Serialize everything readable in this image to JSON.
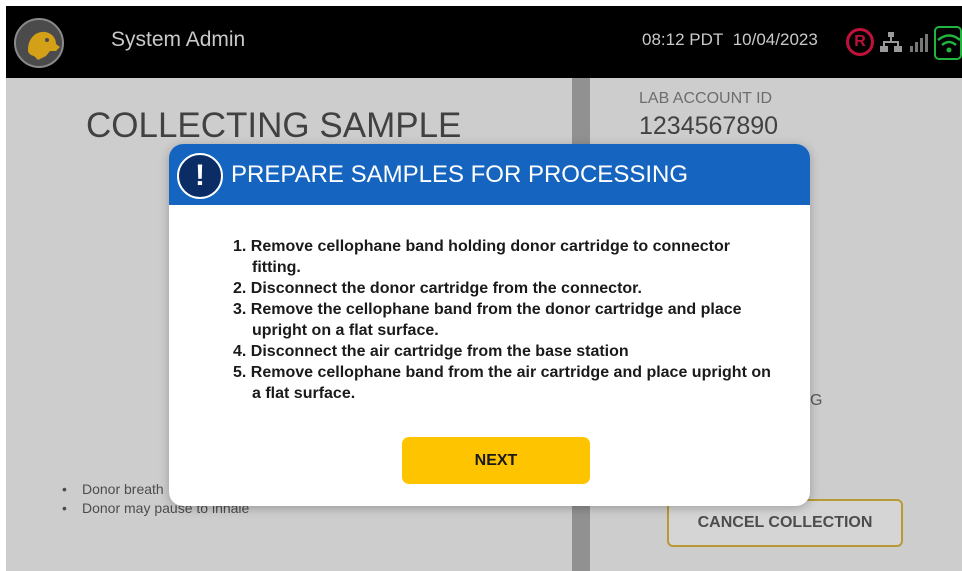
{
  "header": {
    "title": "System Admin",
    "time": "08:12 PDT",
    "date": "10/04/2023",
    "record_indicator": "R",
    "icons": [
      "dog-logo-icon",
      "record-icon",
      "network-icon",
      "signal-icon",
      "wifi-icon"
    ]
  },
  "main": {
    "title": "COLLECTING SAMPLE",
    "instructions": [
      "Donor breath",
      "Donor may pause to inhale"
    ]
  },
  "side_panel": {
    "account_label": "LAB ACCOUNT ID",
    "account_id": "1234567890",
    "status_fragment": "G",
    "cancel_label": "CANCEL COLLECTION"
  },
  "modal": {
    "title": "PREPARE SAMPLES FOR PROCESSING",
    "steps": [
      "1. Remove cellophane band holding donor cartridge to connector fitting.",
      "2. Disconnect the donor cartridge from the connector.",
      "3. Remove the cellophane band from the donor cartridge and place upright on a flat surface.",
      "4. Disconnect the air cartridge from the base station",
      "5. Remove cellophane band from the air cartridge and place upright on a flat surface."
    ],
    "next_label": "NEXT"
  },
  "colors": {
    "modal_header": "#1565c0",
    "next_button": "#ffc400",
    "cancel_border": "#c79a00",
    "record_red": "#c0113a",
    "wifi_green": "#21b53e"
  }
}
